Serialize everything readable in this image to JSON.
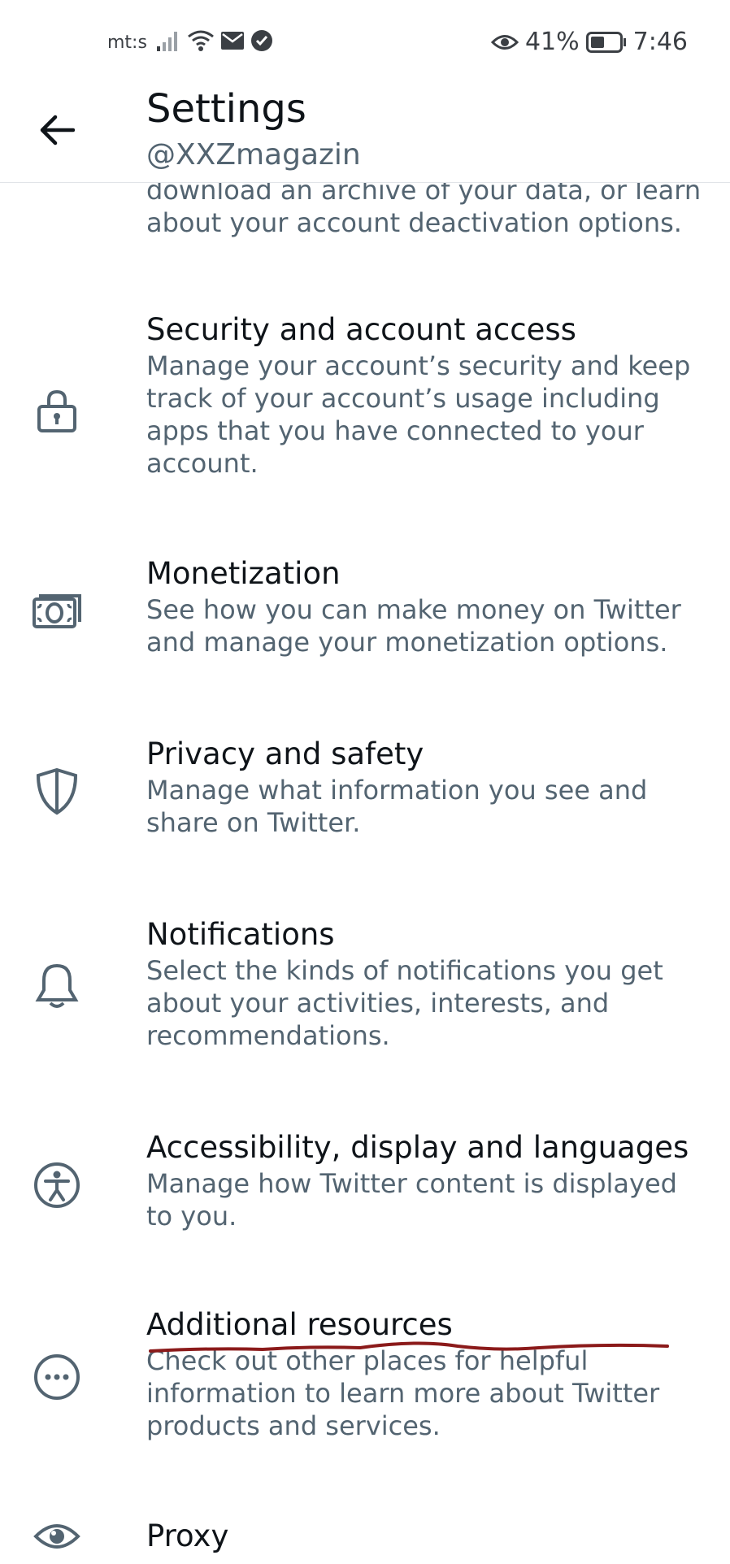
{
  "status_bar": {
    "carrier": "mt:s",
    "battery": "41%",
    "time": "7:46"
  },
  "header": {
    "title": "Settings",
    "handle": "@XXZmagazin"
  },
  "partial_item": {
    "desc": "download an archive of your data, or learn about your account deactivation options."
  },
  "items": [
    {
      "title": "Security and account access",
      "desc": "Manage your account’s security and keep track of your account’s usage including apps that you have connected to your account.",
      "icon": "lock-icon"
    },
    {
      "title": "Monetization",
      "desc": "See how you can make money on Twitter and manage your monetization options.",
      "icon": "money-icon"
    },
    {
      "title": "Privacy and safety",
      "desc": "Manage what information you see and share on Twitter.",
      "icon": "shield-icon"
    },
    {
      "title": "Notifications",
      "desc": "Select the kinds of notifications you get about your activities, interests, and recommendations.",
      "icon": "bell-icon"
    },
    {
      "title": "Accessibility, display and languages",
      "desc": "Manage how Twitter content is displayed to you.",
      "icon": "accessibility-icon"
    },
    {
      "title": "Additional resources",
      "desc": "Check out other places for helpful information to learn more about Twitter products and services.",
      "icon": "more-icon"
    },
    {
      "title": "Proxy",
      "desc": "",
      "icon": "eye-icon"
    }
  ],
  "colors": {
    "primary_text": "#0f1419",
    "secondary_text": "#536471",
    "annotation": "#8b1a1a"
  }
}
